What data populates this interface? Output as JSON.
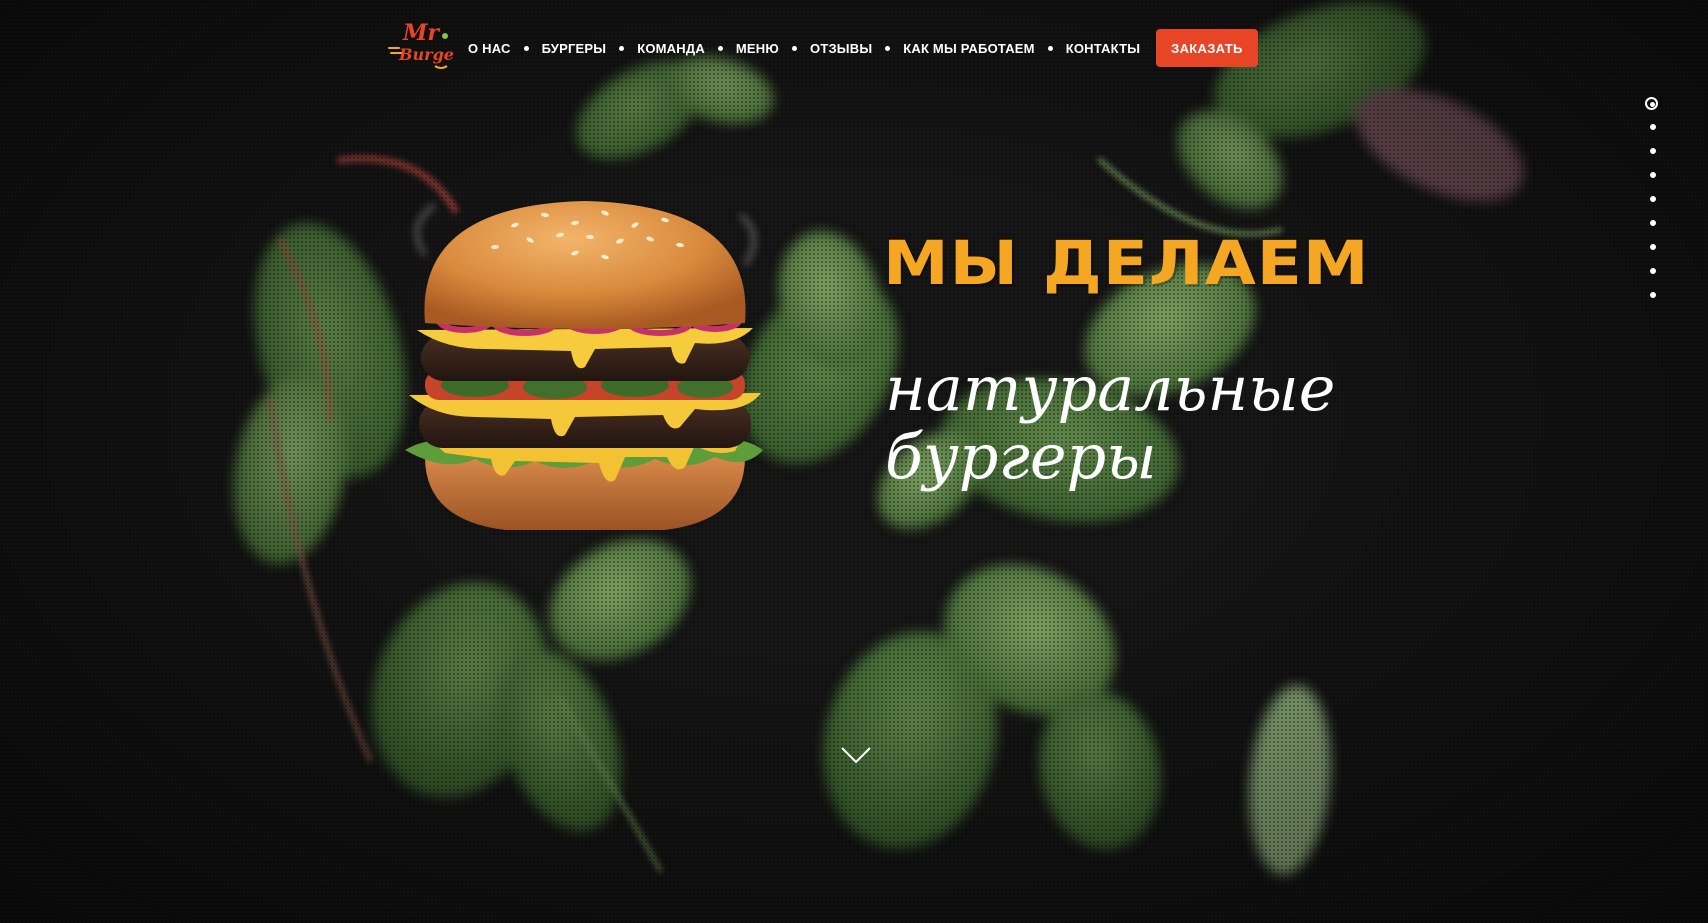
{
  "logo": {
    "text_top": "Mr",
    "text_bottom": "Burger",
    "accent_color": "#e84426",
    "secondary_color": "#f5a623"
  },
  "nav": {
    "items": [
      {
        "label": "О НАС"
      },
      {
        "label": "БУРГЕРЫ"
      },
      {
        "label": "КОМАНДА"
      },
      {
        "label": "МЕНЮ"
      },
      {
        "label": "ОТЗЫВЫ"
      },
      {
        "label": "КАК МЫ РАБОТАЕМ"
      },
      {
        "label": "КОНТАКТЫ"
      }
    ],
    "order_button": "ЗАКАЗАТЬ"
  },
  "hero": {
    "headline": "МЫ ДЕЛАЕМ",
    "subline_1": "натуральные",
    "subline_2": "бургеры",
    "headline_color": "#f5a623",
    "subline_color": "#ffffff"
  },
  "pager": {
    "total": 9,
    "active_index": 0
  },
  "icons": {
    "scroll": "chevron-down-icon",
    "logo": "burger-logo-icon"
  },
  "colors": {
    "background": "#141414",
    "accent": "#e84426",
    "brand_orange": "#f5a623",
    "leaf_green": "#5b8a45"
  }
}
